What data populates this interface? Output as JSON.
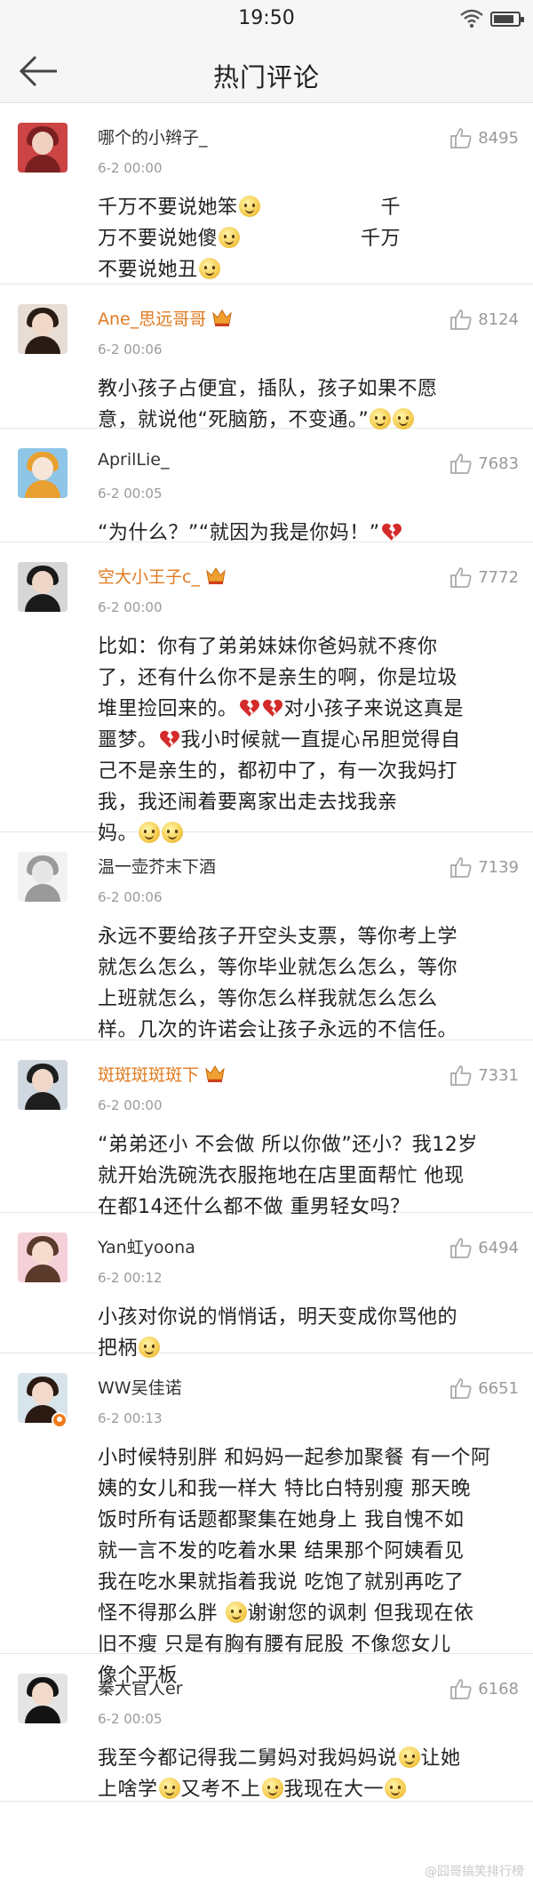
{
  "status_bar": {
    "time": "19:50"
  },
  "header": {
    "title": "热门评论"
  },
  "comments": [
    {
      "name": "哪个的小辫子_",
      "time": "6-2 00:00",
      "likes": "8495",
      "lines": [
        [
          {
            "t": "千万不要说她笨"
          },
          {
            "e": "smile"
          },
          {
            "t": "　　　　　　千"
          }
        ],
        [
          {
            "t": "万不要说她傻"
          },
          {
            "e": "smile"
          },
          {
            "t": "　　　　　　千万"
          }
        ],
        [
          {
            "t": "不要说她丑"
          },
          {
            "e": "smile"
          }
        ]
      ]
    },
    {
      "name": "Ane_思远哥哥",
      "time": "6-2 00:06",
      "likes": "8124",
      "lines": [
        [
          {
            "t": "教小孩子占便宜，插队，孩子如果不愿"
          }
        ],
        [
          {
            "t": "意，就说他“死脑筋，不变通。”"
          },
          {
            "e": "smile"
          },
          {
            "e": "smile"
          }
        ]
      ]
    },
    {
      "name": "AprilLie_",
      "time": "6-2 00:05",
      "likes": "7683",
      "lines": [
        [
          {
            "t": "“为什么？”“就因为我是你妈！”"
          },
          {
            "e": "heart"
          }
        ]
      ]
    },
    {
      "name": "空大小王子c_",
      "time": "6-2 00:00",
      "likes": "7772",
      "lines": [
        [
          {
            "t": "比如：你有了弟弟妹妹你爸妈就不疼你"
          }
        ],
        [
          {
            "t": "了，还有什么你不是亲生的啊，你是垃圾"
          }
        ],
        [
          {
            "t": "堆里捡回来的。"
          },
          {
            "e": "heart"
          },
          {
            "e": "heart"
          },
          {
            "t": "对小孩子来说这真是"
          }
        ],
        [
          {
            "t": "噩梦。"
          },
          {
            "e": "heart"
          },
          {
            "t": "我小时候就一直提心吊胆觉得自"
          }
        ],
        [
          {
            "t": "己不是亲生的，都初中了，有一次我妈打"
          }
        ],
        [
          {
            "t": "我，我还闹着要离家出走去找我亲"
          }
        ],
        [
          {
            "t": "妈。"
          },
          {
            "e": "smile"
          },
          {
            "e": "smile"
          }
        ]
      ]
    },
    {
      "name": "温一壶芥末下酒",
      "time": "6-2 00:06",
      "likes": "7139",
      "lines": [
        [
          {
            "t": "永远不要给孩子开空头支票，等你考上学"
          }
        ],
        [
          {
            "t": "就怎么怎么，等你毕业就怎么怎么，等你"
          }
        ],
        [
          {
            "t": "上班就怎么，等你怎么样我就怎么怎么"
          }
        ],
        [
          {
            "t": "样。几次的许诺会让孩子永远的不信任。"
          }
        ]
      ]
    },
    {
      "name": "斑斑斑斑斑下",
      "time": "6-2 00:00",
      "likes": "7331",
      "lines": [
        [
          {
            "t": "“弟弟还小 不会做 所以你做”还小？我12岁"
          }
        ],
        [
          {
            "t": "就开始洗碗洗衣服拖地在店里面帮忙 他现"
          }
        ],
        [
          {
            "t": "在都14还什么都不做 重男轻女吗？"
          }
        ]
      ]
    },
    {
      "name": "Yan虹yoona",
      "time": "6-2 00:12",
      "likes": "6494",
      "lines": [
        [
          {
            "t": "小孩对你说的悄悄话，明天变成你骂他的"
          }
        ],
        [
          {
            "t": "把柄"
          },
          {
            "e": "smile"
          }
        ]
      ]
    },
    {
      "name": "WW吴佳诺",
      "time": "6-2 00:13",
      "likes": "6651",
      "lines": [
        [
          {
            "t": "小时候特别胖 和妈妈一起参加聚餐 有一个阿"
          }
        ],
        [
          {
            "t": "姨的女儿和我一样大 特比白特别瘦 那天晚"
          }
        ],
        [
          {
            "t": "饭时所有话题都聚集在她身上 我自愧不如"
          }
        ],
        [
          {
            "t": "就一言不发的吃着水果 结果那个阿姨看见"
          }
        ],
        [
          {
            "t": "我在吃水果就指着我说 吃饱了就别再吃了"
          }
        ],
        [
          {
            "t": "怪不得那么胖 "
          },
          {
            "e": "smile"
          },
          {
            "t": "谢谢您的讽刺 但我现在依"
          }
        ],
        [
          {
            "t": "旧不瘦 只是有胸有腰有屁股 不像您女儿"
          }
        ],
        [
          {
            "t": "像个平板"
          }
        ]
      ]
    },
    {
      "name": "秦大官人er",
      "time": "6-2 00:05",
      "likes": "6168",
      "lines": [
        [
          {
            "t": "我至今都记得我二舅妈对我妈妈说"
          },
          {
            "e": "smile"
          },
          {
            "t": "让她"
          }
        ],
        [
          {
            "t": "上啥学"
          },
          {
            "e": "smile"
          },
          {
            "t": "又考不上"
          },
          {
            "e": "smile"
          },
          {
            "t": "我现在大一"
          },
          {
            "e": "smile"
          }
        ]
      ]
    }
  ],
  "watermark": "@囧哥搞笑排行榜"
}
